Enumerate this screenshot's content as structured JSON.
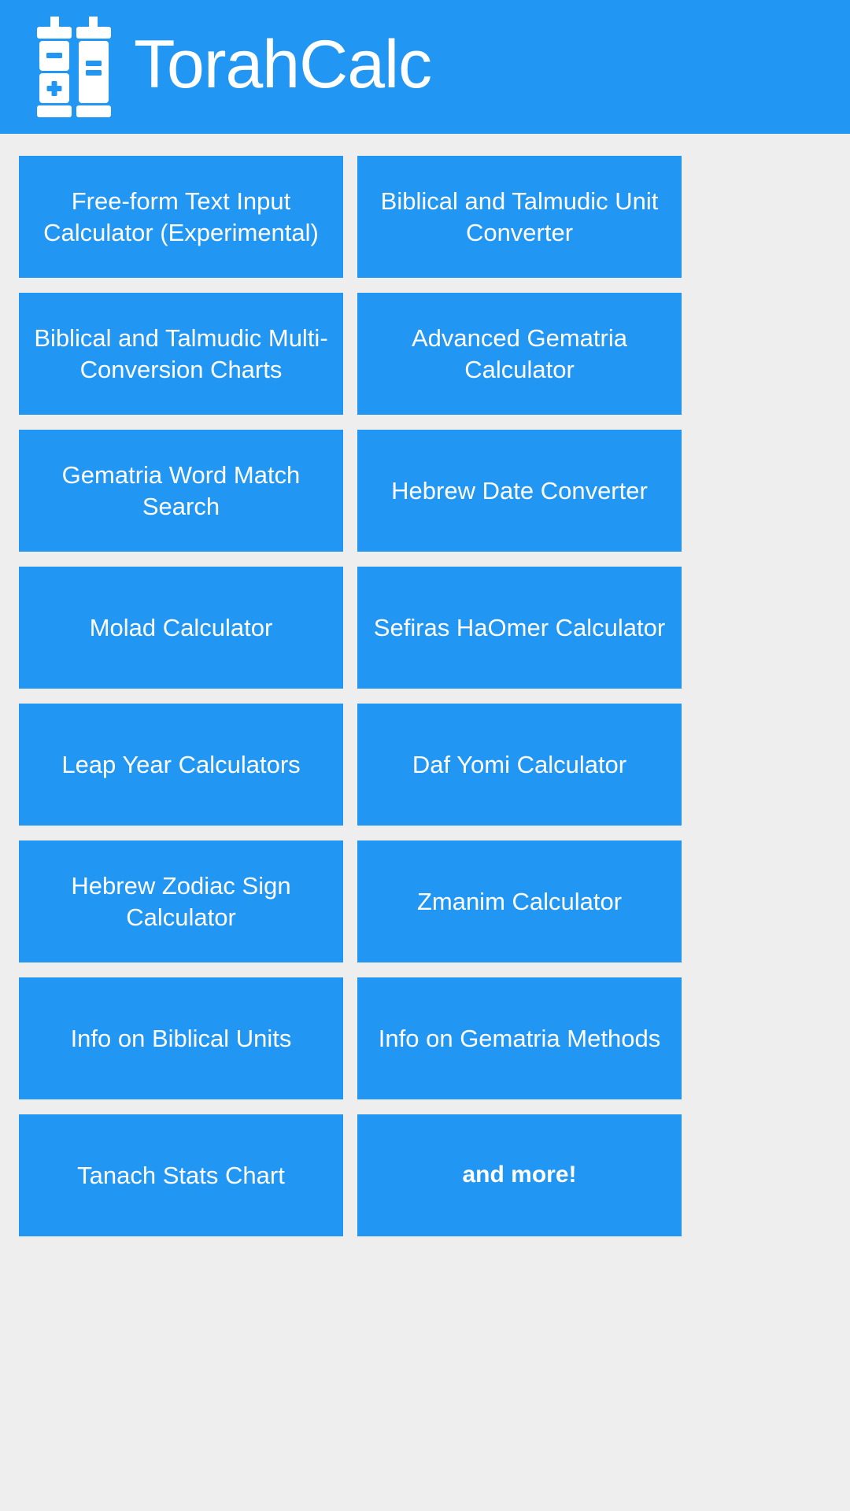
{
  "header": {
    "title": "TorahCalc",
    "logo_icon": "torah-scroll-calculator-icon",
    "background_color": "#2196f3",
    "text_color": "#ffffff"
  },
  "theme": {
    "page_background": "#eeeeee",
    "tile_background": "#2196f3",
    "tile_text_color": "#ffffff"
  },
  "menu": {
    "columns": 2,
    "tiles": [
      {
        "label": "Free-form Text Input Calculator (Experimental)",
        "bold": false
      },
      {
        "label": "Biblical and Talmudic Unit Converter",
        "bold": false
      },
      {
        "label": "Biblical and Talmudic Multi-Conversion Charts",
        "bold": false
      },
      {
        "label": "Advanced Gematria Calculator",
        "bold": false
      },
      {
        "label": "Gematria Word Match Search",
        "bold": false
      },
      {
        "label": "Hebrew Date Converter",
        "bold": false
      },
      {
        "label": "Molad Calculator",
        "bold": false
      },
      {
        "label": "Sefiras HaOmer Calculator",
        "bold": false
      },
      {
        "label": "Leap Year Calculators",
        "bold": false
      },
      {
        "label": "Daf Yomi Calculator",
        "bold": false
      },
      {
        "label": "Hebrew Zodiac Sign Calculator",
        "bold": false
      },
      {
        "label": "Zmanim Calculator",
        "bold": false
      },
      {
        "label": "Info on Biblical Units",
        "bold": false
      },
      {
        "label": "Info on Gematria Methods",
        "bold": false
      },
      {
        "label": "Tanach Stats Chart",
        "bold": false
      },
      {
        "label": "and more!",
        "bold": true
      }
    ]
  }
}
